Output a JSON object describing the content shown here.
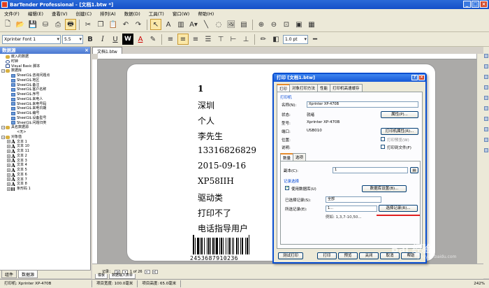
{
  "window": {
    "title": "BarTender Professional - [文档1.btw *]"
  },
  "menu": [
    "文件(F)",
    "编辑(E)",
    "查看(V)",
    "创建(C)",
    "排列(A)",
    "数据(D)",
    "工具(T)",
    "窗口(W)",
    "帮助(H)"
  ],
  "toolbar": {
    "font_name": "Xprinter Font 1",
    "font_size": "5.5",
    "line_width": "1.0 pt",
    "bold": "B",
    "italic": "I",
    "underline": "U",
    "reverse": "W"
  },
  "left_panel": {
    "title": "数据源",
    "tree": [
      {
        "level": 0,
        "icon": "db",
        "label": "嵌入的数据"
      },
      {
        "level": 0,
        "icon": "clock",
        "label": "时钟"
      },
      {
        "level": 0,
        "icon": "vb",
        "label": "Visual Basic 脚本"
      },
      {
        "level": 0,
        "icon": "db",
        "label": "数据库",
        "exp": "−"
      },
      {
        "level": 1,
        "icon": "sheet",
        "label": "Sheet1$.咨询问题点"
      },
      {
        "level": 1,
        "icon": "sheet",
        "label": "Sheet1$.地区"
      },
      {
        "level": 1,
        "icon": "sheet",
        "label": "Sheet1$.备注"
      },
      {
        "level": 1,
        "icon": "sheet",
        "label": "Sheet1$.客户名称"
      },
      {
        "level": 1,
        "icon": "sheet",
        "label": "Sheet1$.序号"
      },
      {
        "level": 1,
        "icon": "sheet",
        "label": "Sheet1$.来电人"
      },
      {
        "level": 1,
        "icon": "sheet",
        "label": "Sheet1$.来电号码"
      },
      {
        "level": 1,
        "icon": "sheet",
        "label": "Sheet1$.来电日期"
      },
      {
        "level": 1,
        "icon": "sheet",
        "label": "Sheet1$.编号"
      },
      {
        "level": 1,
        "icon": "sheet",
        "label": "Sheet1$.设备型号"
      },
      {
        "level": 1,
        "icon": "sheet",
        "label": "Sheet1$.问题归类"
      },
      {
        "level": 0,
        "icon": "db",
        "label": "具名数据源",
        "exp": "−"
      },
      {
        "level": 1,
        "icon": "",
        "label": "<无>"
      },
      {
        "level": 0,
        "icon": "db",
        "label": "对象值",
        "exp": "−"
      },
      {
        "level": 1,
        "icon": "txt",
        "label": "文本 1",
        "exp": "+"
      },
      {
        "level": 1,
        "icon": "txt",
        "label": "文本 10",
        "exp": "+"
      },
      {
        "level": 1,
        "icon": "txt",
        "label": "文本 11",
        "exp": "+"
      },
      {
        "level": 1,
        "icon": "txt",
        "label": "文本 2",
        "exp": "+"
      },
      {
        "level": 1,
        "icon": "txt",
        "label": "文本 3",
        "exp": "+"
      },
      {
        "level": 1,
        "icon": "txt",
        "label": "文本 4",
        "exp": "+"
      },
      {
        "level": 1,
        "icon": "txt",
        "label": "文本 5",
        "exp": "+"
      },
      {
        "level": 1,
        "icon": "txt",
        "label": "文本 6",
        "exp": "+"
      },
      {
        "level": 1,
        "icon": "txt",
        "label": "文本 7",
        "exp": "+"
      },
      {
        "level": 1,
        "icon": "txt",
        "label": "文本 8",
        "exp": "+"
      },
      {
        "level": 1,
        "icon": "bc",
        "label": "条形码 1",
        "exp": "+"
      }
    ],
    "tabs": [
      "组件",
      "数据源"
    ]
  },
  "document": {
    "tab": "文档1.btw"
  },
  "label": {
    "lines": [
      "1",
      "深圳",
      "个人",
      "李先生",
      "13316826829",
      "2015-09-16",
      "XP58IIH",
      "驱动类",
      "打印不了",
      "电话指导用户"
    ],
    "barcode_number": "2453687910236"
  },
  "records": {
    "label": "记录：",
    "current": "1",
    "of_text": "1 of 26"
  },
  "view_tabs": [
    "模板",
    "数据输入表单"
  ],
  "status": {
    "printer": "打印机: Xprinter XP-470B",
    "width": "项目宽度: 100.0毫米",
    "height": "项目高度: 65.0毫米",
    "zoom": "242%"
  },
  "dialog": {
    "title": "打印 [文档1.btw]",
    "tabs": [
      "打印",
      "对象打印方法",
      "性能",
      "打印机高速缓存"
    ],
    "printer_group": "打印机",
    "name_label": "名称(N):",
    "name_value": "Xprinter XP-470B",
    "status_label": "状态:",
    "status_value": "就绪",
    "model_label": "型号:",
    "model_value": "Xprinter XP-470B",
    "port_label": "端口:",
    "port_value": "USB010",
    "location_label": "位置:",
    "comment_label": "说明:",
    "properties_btn": "属性(P)...",
    "driver_btn": "打印机属性(R)...",
    "preview_label": "打印预览(W)",
    "to_file_label": "打印到文件(F)",
    "inner_tabs": [
      "数量",
      "选项"
    ],
    "copies_label": "副本(C):",
    "copies_value": "1",
    "records_group": "记录选择",
    "use_db_label": "使用数据库(U)",
    "db_setup_btn": "数据库设置(B)...",
    "select_records_label": "已选择记录(S):",
    "select_records_value": "全部",
    "query_label": "所选记录(E):",
    "query_value": "1...",
    "choose_records_btn": "选择记录(R)...",
    "example_label": "例如: 1,3,7-10,50...",
    "bottom_buttons": [
      "测试打印",
      "打印",
      "预览",
      "关闭",
      "取消",
      "帮助"
    ]
  },
  "watermark": {
    "brand": "Bai 经验",
    "site": "jingyan.baidu.com"
  }
}
